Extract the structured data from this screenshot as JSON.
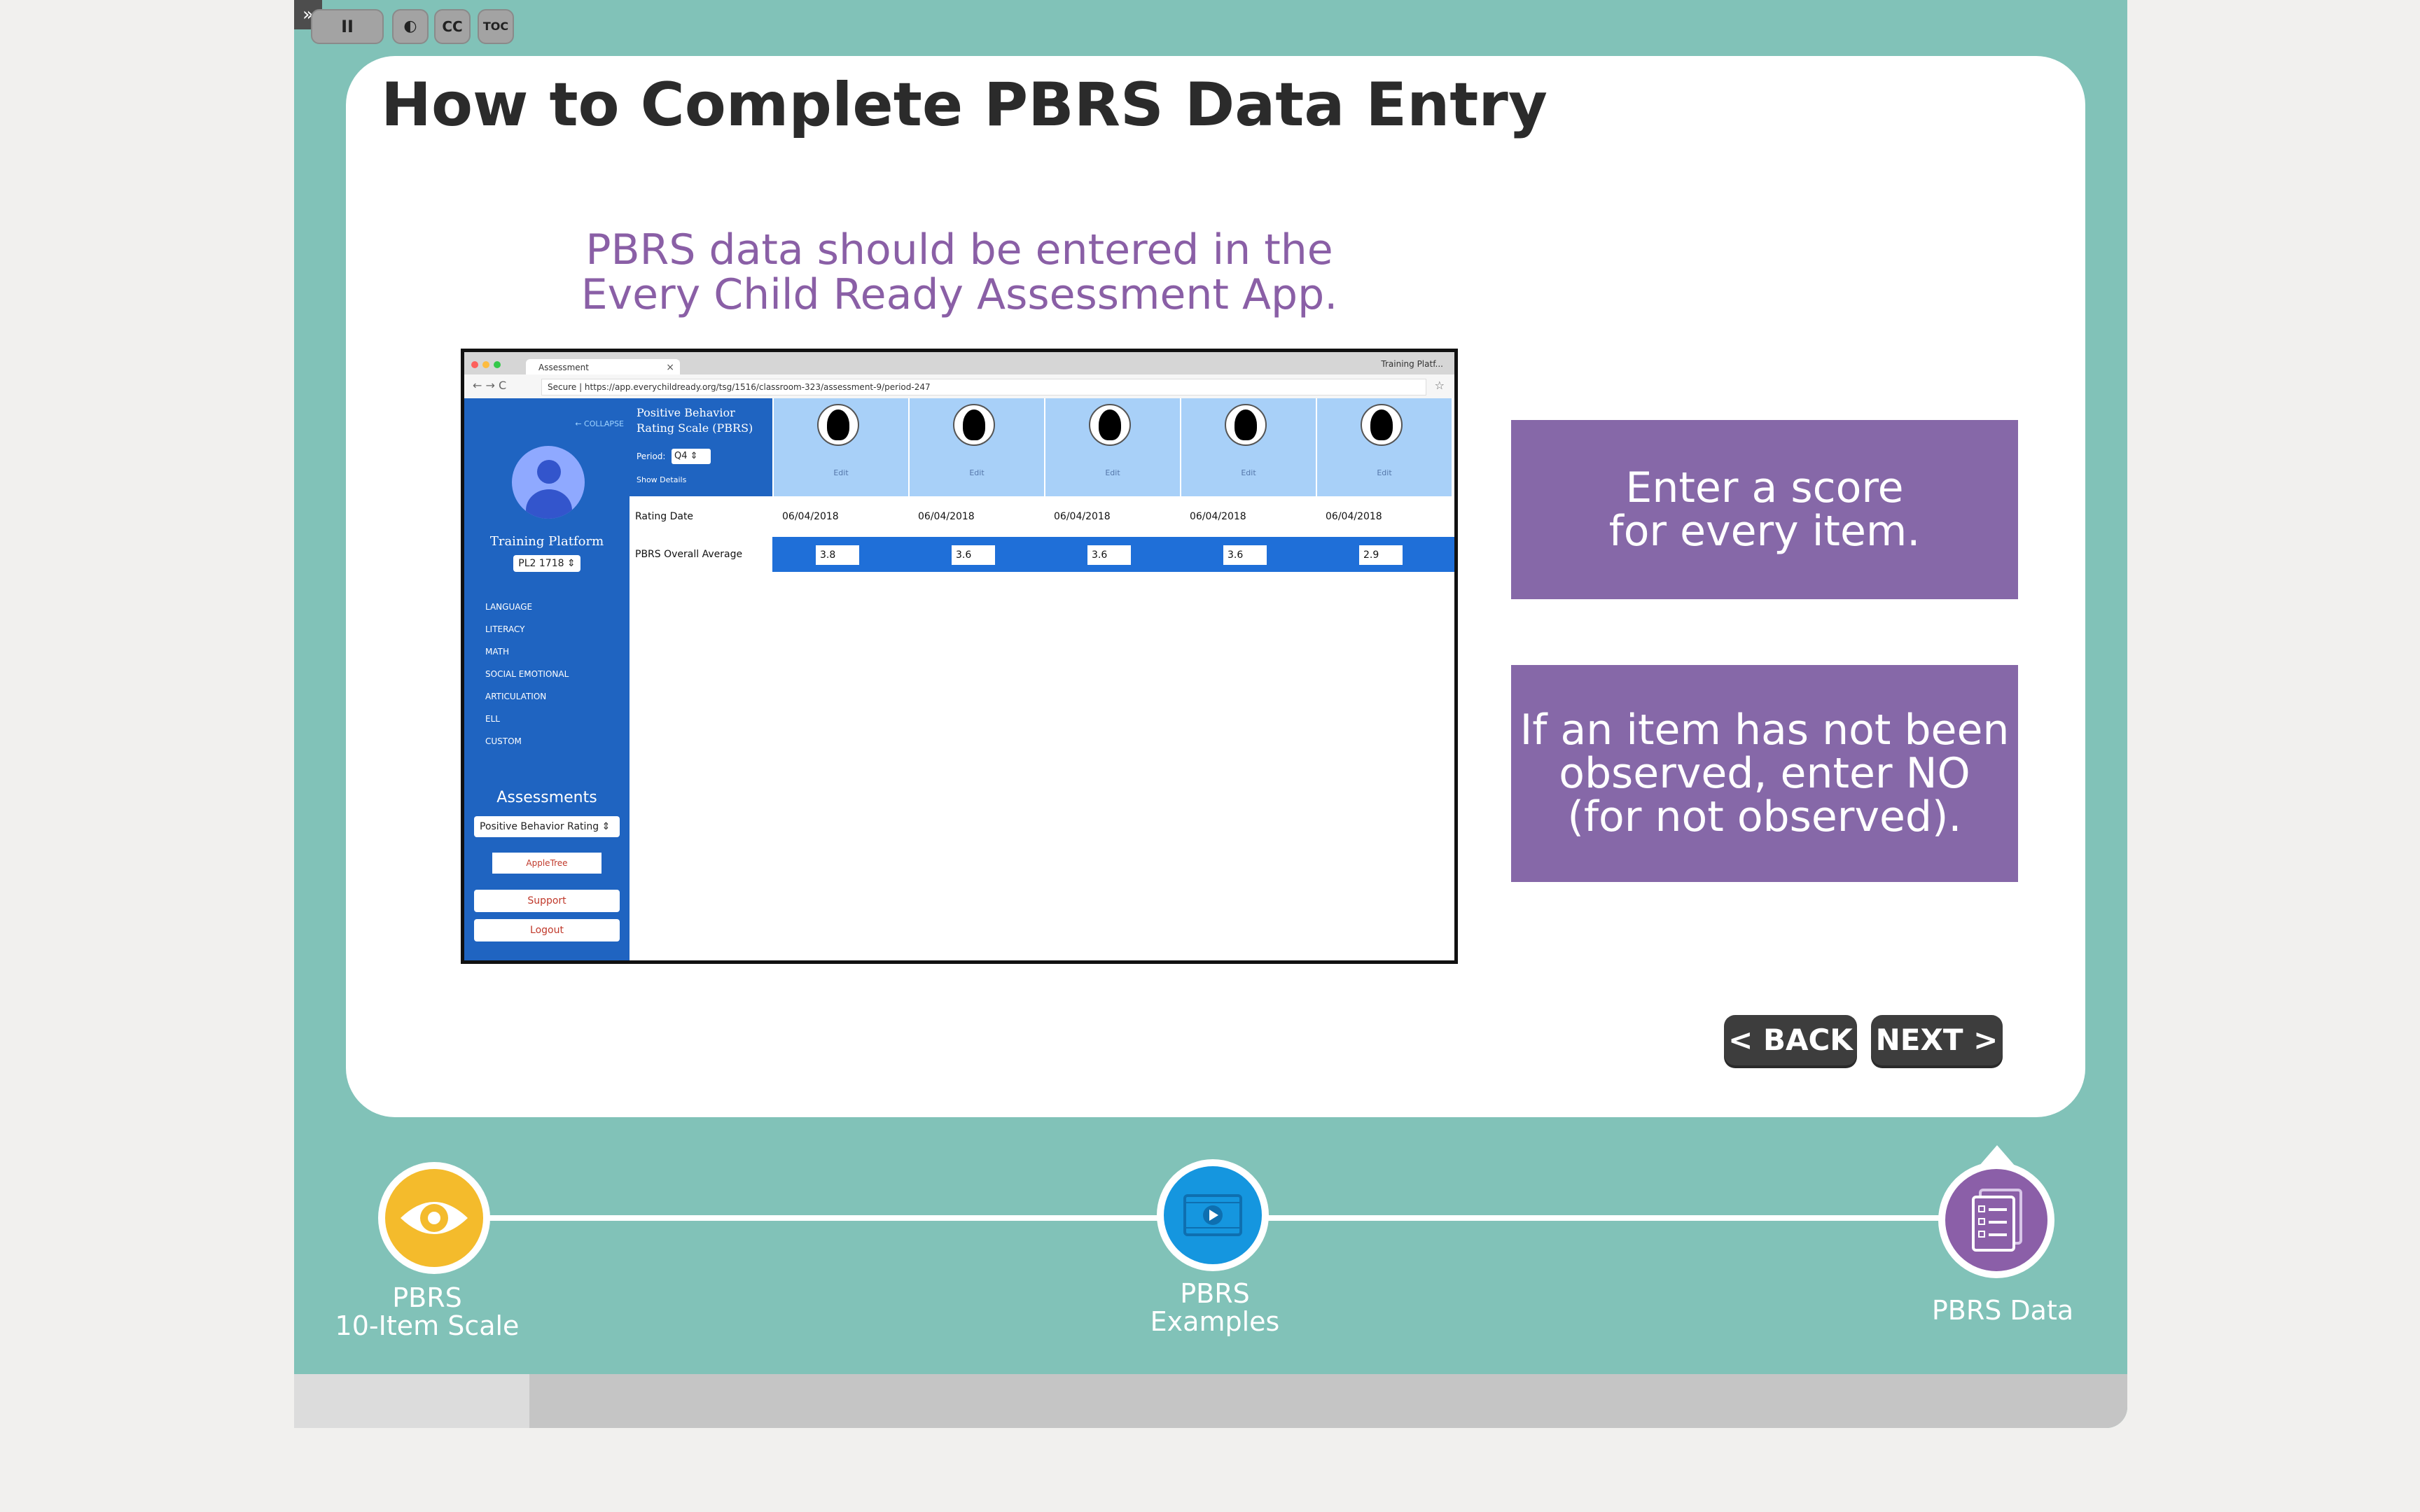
{
  "slide": {
    "title": "How to Complete PBRS Data Entry",
    "subtitle_line1": "PBRS data should be entered in the",
    "subtitle_line2": "Every Child Ready Assessment App.",
    "callout1_line1": "Enter a score",
    "callout1_line2": "for every item.",
    "callout2_line1": "If an item has not been",
    "callout2_line2": "observed, enter NO",
    "callout2_line3": "(for not observed).",
    "back_label": "< BACK",
    "next_label": "NEXT >"
  },
  "screenshot": {
    "browser_tab": "Assessment",
    "tab_close": "×",
    "tab_right": "Training Platf...",
    "nav_arrows": "← → C",
    "url": "Secure | https://app.everychildready.org/tsg/1516/classroom-323/assessment-9/period-247",
    "star": "☆",
    "sidebar": {
      "collapse": "← COLLAPSE",
      "platform_name": "Training Platform",
      "platform_select": "PL2 1718 ⇕",
      "subjects": [
        "LANGUAGE",
        "LITERACY",
        "MATH",
        "SOCIAL EMOTIONAL",
        "ARTICULATION",
        "ELL",
        "CUSTOM"
      ],
      "assessments_heading": "Assessments",
      "assessment_select": "Positive Behavior Rating ⇕",
      "brand": "AppleTree",
      "support": "Support",
      "logout": "Logout"
    },
    "grid": {
      "scale_title": "Positive Behavior Rating Scale (PBRS)",
      "period_label": "Period:",
      "period_value": "Q4 ⇕",
      "show_details": "Show Details",
      "edit_label": "Edit",
      "rating_date_label": "Rating Date",
      "average_label": "PBRS Overall Average",
      "dates": [
        "06/04/2018",
        "06/04/2018",
        "06/04/2018",
        "06/04/2018",
        "06/04/2018"
      ],
      "scores": [
        "3.8",
        "3.6",
        "3.6",
        "3.6",
        "2.9"
      ]
    }
  },
  "timeline": {
    "step1_line1": "PBRS",
    "step1_line2": "10-Item Scale",
    "step2_line1": "PBRS",
    "step2_line2": "Examples",
    "step3": "PBRS Data"
  },
  "player": {
    "expand": "»",
    "pause": "II",
    "volume": "◐",
    "cc": "CC",
    "toc": "TOC"
  },
  "colors": {
    "frame": "#81c2b8",
    "accent_purple": "#8668a8",
    "app_blue": "#1f64c1",
    "step1": "#f4bb2c",
    "step2": "#1596df",
    "step3": "#8b5fa8"
  },
  "icons": {
    "step1": "eye-icon",
    "step2": "video-icon",
    "step3": "checklist-icon"
  }
}
